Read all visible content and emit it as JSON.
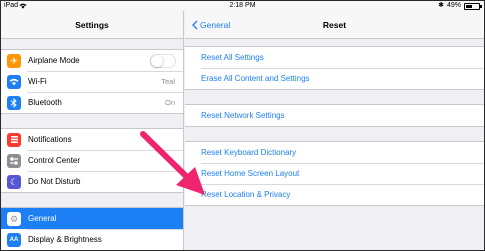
{
  "status_bar": {
    "device": "iPad",
    "time": "2:18 PM",
    "battery_text": "49%",
    "battery_level": 0.49
  },
  "sidebar": {
    "title": "Settings",
    "groups": [
      [
        {
          "label": "Airplane Mode",
          "icon": "airplane-icon",
          "icon_color": "#ff9500",
          "control": "toggle",
          "toggle_on": false
        },
        {
          "label": "Wi-Fi",
          "icon": "wifi-icon",
          "icon_color": "#1d7ff4",
          "value": "Teal"
        },
        {
          "label": "Bluetooth",
          "icon": "bluetooth-icon",
          "icon_color": "#1d7ff4",
          "value": "On"
        }
      ],
      [
        {
          "label": "Notifications",
          "icon": "notifications-icon",
          "icon_color": "#ff3b30"
        },
        {
          "label": "Control Center",
          "icon": "control-center-icon",
          "icon_color": "#8e8e93"
        },
        {
          "label": "Do Not Disturb",
          "icon": "moon-icon",
          "icon_color": "#5856d6"
        }
      ],
      [
        {
          "label": "General",
          "icon": "gear-icon",
          "icon_color": "#8e8e93",
          "selected": true
        },
        {
          "label": "Display & Brightness",
          "icon": "display-icon",
          "icon_color": "#1d7ff4"
        }
      ]
    ]
  },
  "detail": {
    "back_label": "General",
    "title": "Reset",
    "groups": [
      [
        "Reset All Settings",
        "Erase All Content and Settings"
      ],
      [
        "Reset Network Settings"
      ],
      [
        "Reset Keyboard Dictionary",
        "Reset Home Screen Layout",
        "Reset Location & Privacy"
      ]
    ]
  },
  "colors": {
    "accent": "#1d7ff4",
    "arrow": "#f0246e"
  }
}
